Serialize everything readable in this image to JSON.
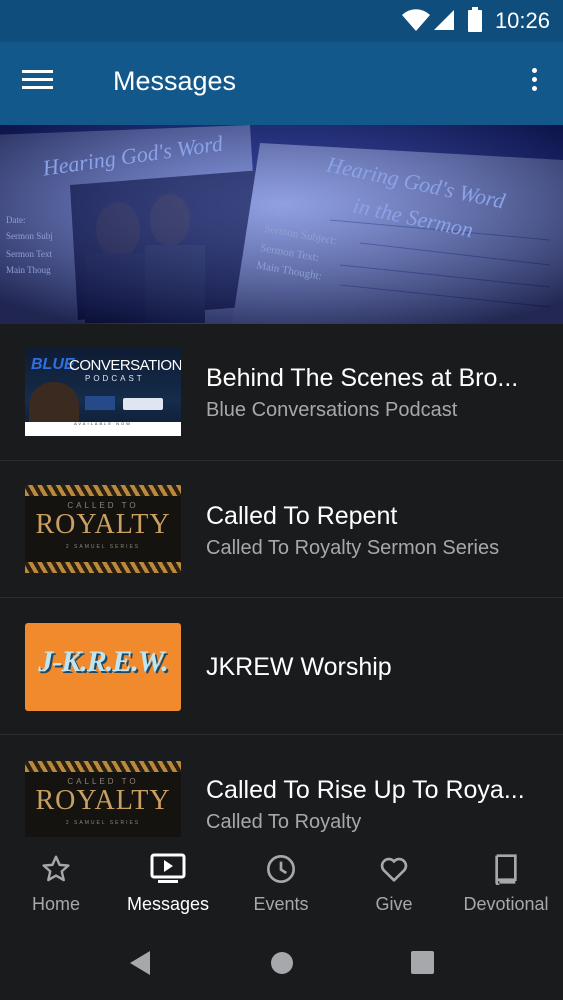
{
  "status_bar": {
    "time": "10:26"
  },
  "app_bar": {
    "title": "Messages"
  },
  "hero": {
    "card_left_text": "Hearing God's Word",
    "card_right_title_1": "Hearing God's Word",
    "card_right_title_2": "in the Sermon",
    "field_date": "Date:",
    "field_subject": "Sermon Subject:",
    "field_text": "Sermon Text:",
    "field_main": "Main Thought:",
    "left_field_date": "Date:",
    "left_field_subject": "Sermon Subj",
    "left_field_text": "Sermon Text",
    "left_field_main": "Main Thoug"
  },
  "messages": [
    {
      "title": "Behind The Scenes at Bro...",
      "subtitle": "Blue Conversations Podcast",
      "thumb": {
        "brand_blue": "BLUE",
        "brand_word": "CONVERSATIONS",
        "brand_sub": "PODCAST",
        "footer": "AVAILABLE NOW"
      }
    },
    {
      "title": "Called To Repent",
      "subtitle": "Called To Royalty Sermon Series",
      "thumb": {
        "top": "CALLED TO",
        "big": "ROYALTY",
        "small": "2 SAMUEL SERIES"
      }
    },
    {
      "title": "JKREW Worship",
      "subtitle": "",
      "thumb": {
        "text": "J-K.R.E.W."
      }
    },
    {
      "title": "Called To Rise Up To Roya...",
      "subtitle": "Called To Royalty",
      "thumb": {
        "top": "CALLED TO",
        "big": "ROYALTY",
        "small": "2 SAMUEL SERIES"
      }
    }
  ],
  "bottom_nav": [
    {
      "label": "Home",
      "icon": "star-icon"
    },
    {
      "label": "Messages",
      "icon": "play-screen-icon",
      "active": true
    },
    {
      "label": "Events",
      "icon": "clock-icon"
    },
    {
      "label": "Give",
      "icon": "heart-icon"
    },
    {
      "label": "Devotional",
      "icon": "book-icon"
    }
  ],
  "colors": {
    "app_bar": "#13588a",
    "status_bar": "#0f4e7c",
    "background": "#1a1b1d",
    "thumb_orange": "#f08a2c",
    "royalty_gold": "#c9a062"
  }
}
